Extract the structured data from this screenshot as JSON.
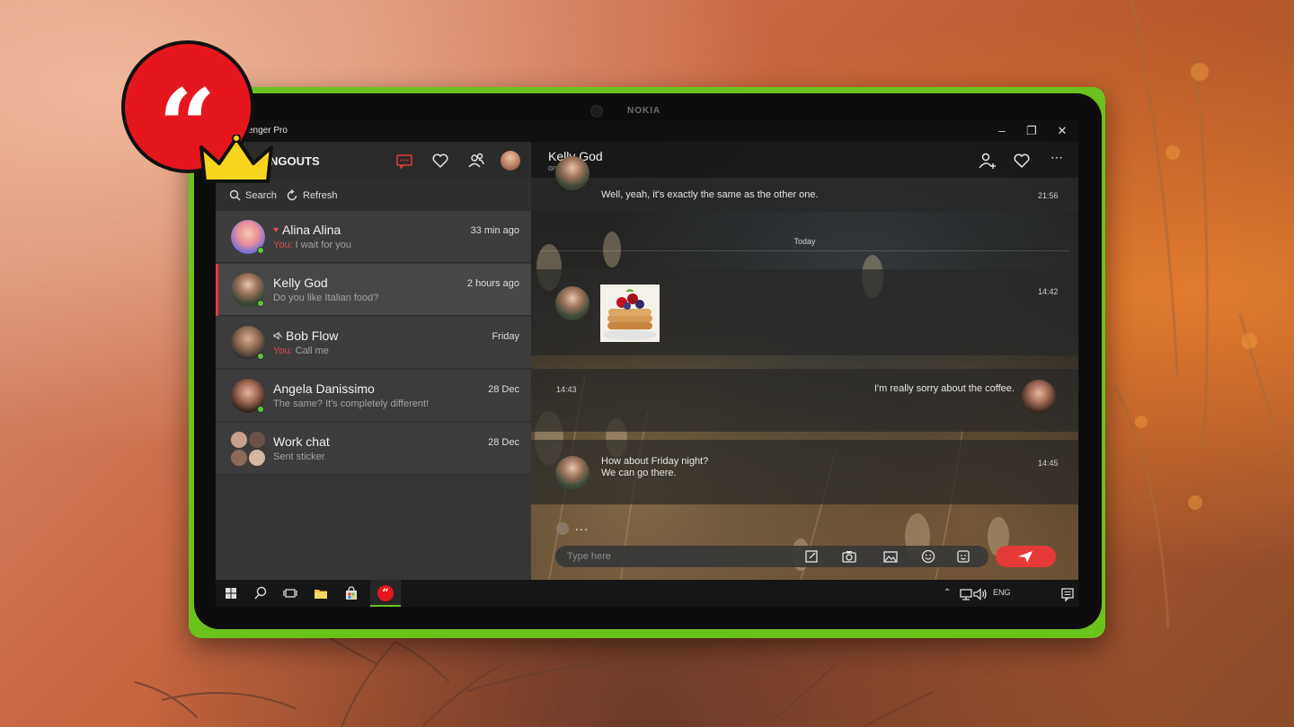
{
  "app": {
    "title": "Messenger Pro",
    "title_visible": "enger Pro",
    "section_title": "NGOUTS"
  },
  "device": {
    "brand": "NOKIA"
  },
  "left_panel": {
    "tools": {
      "search": "Search",
      "refresh": "Refresh"
    },
    "conversations": [
      {
        "name": "Alina Alina",
        "preview_prefix": "You:",
        "preview": "I wait for you",
        "time": "33 min ago",
        "favorite": true,
        "online": true
      },
      {
        "name": "Kelly God",
        "preview_prefix": "",
        "preview": "Do you like Italian food?",
        "time": "2 hours ago",
        "active": true,
        "online": true
      },
      {
        "name": "Bob Flow",
        "preview_prefix": "You:",
        "preview": "Call me",
        "time": "Friday",
        "muted": true,
        "online": true
      },
      {
        "name": "Angela Danissimo",
        "preview_prefix": "",
        "preview": "The same? It's completely different!",
        "time": "28 Dec",
        "online": true
      },
      {
        "name": "Work chat",
        "preview_prefix": "",
        "preview": "Sent sticker",
        "time": "28 Dec"
      }
    ]
  },
  "chat": {
    "contact_name": "Kelly God",
    "contact_status": "online",
    "day_separator": "Today",
    "messages": [
      {
        "text": "Well, yeah, it's exactly the same as the other one.",
        "time": "21:56",
        "side": "left"
      },
      {
        "text": "",
        "time": "14:42",
        "side": "left",
        "attachment": "image"
      },
      {
        "text": "I'm really sorry about the coffee.",
        "time": "14:43",
        "side": "right"
      },
      {
        "text_line1": "How about Friday night?",
        "text_line2": "We can go there.",
        "time": "14:45",
        "side": "left"
      }
    ],
    "typing_indicator": "…",
    "composer": {
      "placeholder": "Type here"
    }
  },
  "taskbar": {
    "language": "ENG"
  },
  "colors": {
    "accent": "#e53935",
    "device": "#6cc21c",
    "online": "#5cc63b"
  }
}
